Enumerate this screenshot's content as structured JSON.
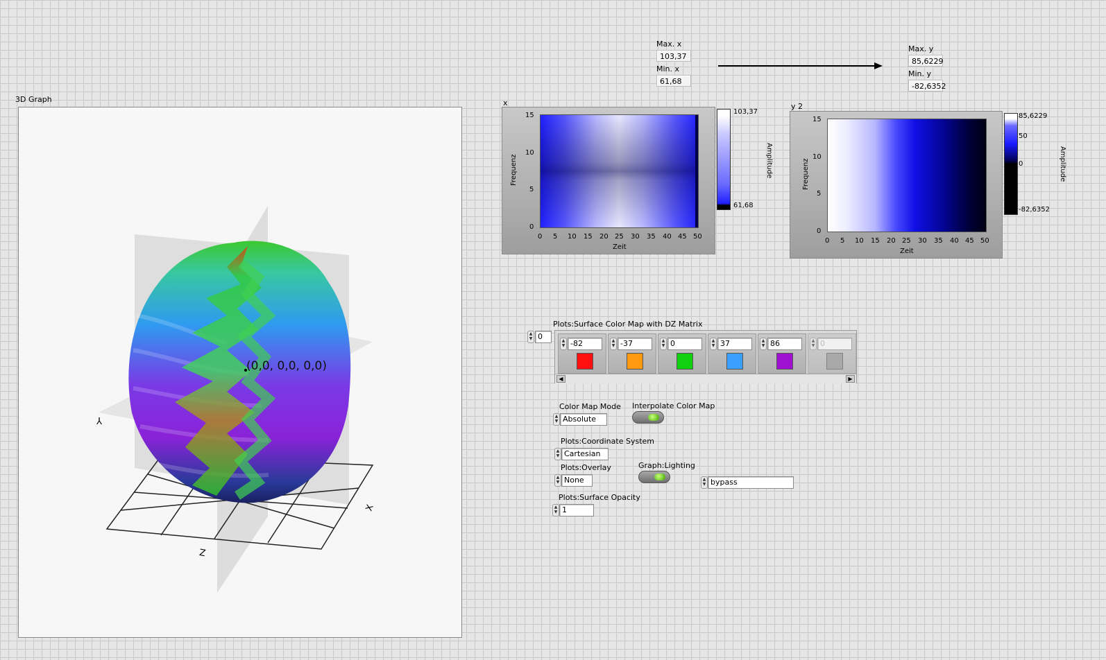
{
  "graph3d": {
    "title": "3D Graph",
    "cursor_label": "(0,0, 0,0, 0,0)",
    "axis_x": "X",
    "axis_y": "Y",
    "axis_z": "Z"
  },
  "indicators": {
    "max_x_label": "Max. x",
    "max_x": "103,37",
    "min_x_label": "Min. x",
    "min_x": "61,68",
    "max_y_label": "Max. y",
    "max_y": "85,6229",
    "min_y_label": "Min. y",
    "min_y": "-82,6352"
  },
  "intensity_x": {
    "title": "x",
    "xlabel": "Zeit",
    "ylabel": "Frequenz",
    "x_ticks": [
      "0",
      "5",
      "10",
      "15",
      "20",
      "25",
      "30",
      "35",
      "40",
      "45",
      "50"
    ],
    "y_ticks": [
      "15",
      "10",
      "5",
      "0"
    ],
    "scale_label": "Amplitude",
    "scale_ticks": [
      "103,37",
      "61,68"
    ]
  },
  "intensity_y": {
    "title": "y 2",
    "xlabel": "Zeit",
    "ylabel": "Frequenz",
    "x_ticks": [
      "0",
      "5",
      "10",
      "15",
      "20",
      "25",
      "30",
      "35",
      "40",
      "45",
      "50"
    ],
    "y_ticks": [
      "15",
      "10",
      "5",
      "0"
    ],
    "scale_label": "Amplitude",
    "scale_ticks": [
      "85,6229",
      "50",
      "0",
      "-82,6352"
    ]
  },
  "color_map": {
    "title": "Plots:Surface Color Map with DZ Matrix",
    "index": "0",
    "entries": [
      {
        "value": "-82",
        "color": "#ff1010"
      },
      {
        "value": "-37",
        "color": "#ff9a10"
      },
      {
        "value": "0",
        "color": "#10d010"
      },
      {
        "value": "37",
        "color": "#3aa0ff"
      },
      {
        "value": "86",
        "color": "#a010d0"
      },
      {
        "value": "0",
        "color": "#909090"
      }
    ]
  },
  "controls": {
    "color_map_mode_label": "Color Map Mode",
    "color_map_mode": "Absolute",
    "interpolate_label": "Interpolate Color Map",
    "coord_system_label": "Plots:Coordinate System",
    "coord_system": "Cartesian",
    "overlay_label": "Plots:Overlay",
    "overlay": "None",
    "lighting_label": "Graph:Lighting",
    "opacity_label": "Plots:Surface Opacity",
    "opacity": "1",
    "bypass": "bypass"
  }
}
